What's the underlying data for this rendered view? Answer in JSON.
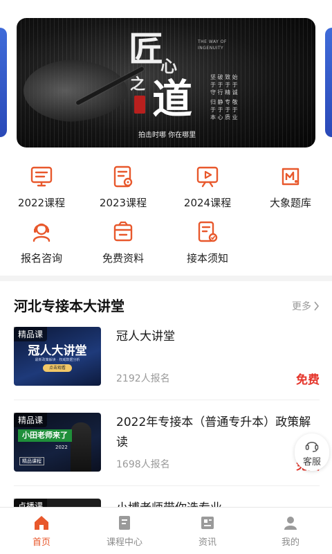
{
  "banner": {
    "title_top": "匠",
    "title_heart": "心",
    "title_zhi": "之",
    "title_dao": "道",
    "english": "THE WAY OF INGENUITY",
    "slogan": "拍击时哪 你在哪里",
    "poem_1": "坚 破 致 始\n于 于 于 于\n守 行 精 诚",
    "poem_2": "归 静 专 敬\n于 于 于 于\n本 心 质 业",
    "slide_count": 5,
    "active_slide": 0
  },
  "categories": [
    {
      "label": "2022课程",
      "icon": "course-board-icon"
    },
    {
      "label": "2023课程",
      "icon": "course-doc-icon"
    },
    {
      "label": "2024课程",
      "icon": "course-play-icon"
    },
    {
      "label": "大象题库",
      "icon": "question-bank-icon"
    },
    {
      "label": "报名咨询",
      "icon": "consult-icon"
    },
    {
      "label": "免费资料",
      "icon": "free-material-icon"
    },
    {
      "label": "接本须知",
      "icon": "notice-icon"
    }
  ],
  "section": {
    "title": "河北专接本大讲堂",
    "more": "更多"
  },
  "courses": [
    {
      "tag": "精品课",
      "title": "冠人大讲堂",
      "count": "2192人报名",
      "price": "免费",
      "thumb_title": "冠人大讲堂",
      "thumb_sub": "最新政策解读 · 权威数据分析",
      "thumb_btn": "点击观看"
    },
    {
      "tag": "精品课",
      "title": "2022年专接本（普通专升本）政策解读",
      "count": "1698人报名",
      "price": "免费",
      "thumb_title": "小田老师来了",
      "thumb_year": "2022",
      "thumb_sub": "精品课程"
    },
    {
      "tag": "点播课",
      "title": "小博老师带你选专业",
      "count": "",
      "price": ""
    }
  ],
  "service": {
    "label": "客服"
  },
  "tabs": [
    {
      "label": "首页",
      "icon": "home-icon",
      "active": true
    },
    {
      "label": "课程中心",
      "icon": "course-center-icon",
      "active": false
    },
    {
      "label": "资讯",
      "icon": "news-icon",
      "active": false
    },
    {
      "label": "我的",
      "icon": "profile-icon",
      "active": false
    }
  ],
  "colors": {
    "accent": "#e8582c",
    "price": "#e5352b",
    "icon": "#e8582c"
  }
}
